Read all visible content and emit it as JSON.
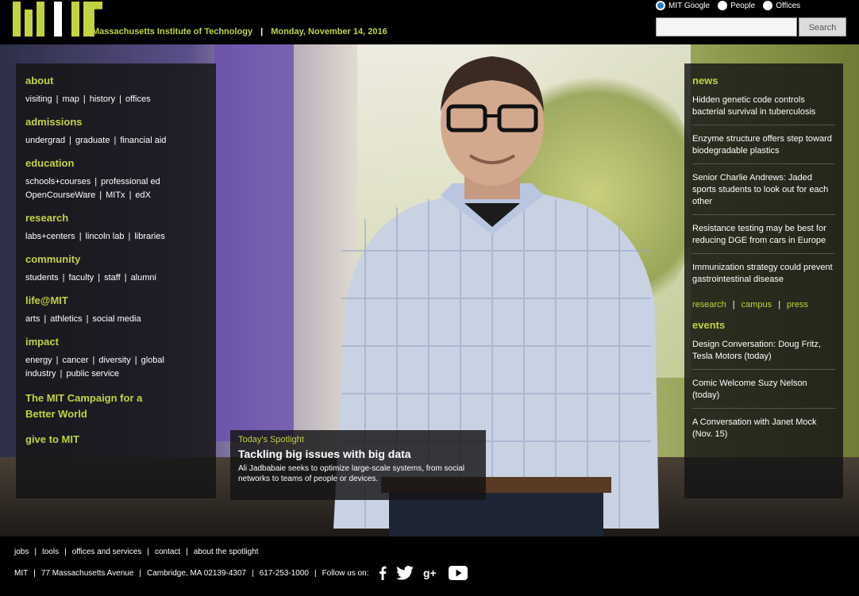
{
  "header": {
    "tagline": "Massachusetts Institute of Technology",
    "date": "Monday, November 14, 2016",
    "search_options": [
      {
        "label": "MIT Google",
        "selected": true
      },
      {
        "label": "People",
        "selected": false
      },
      {
        "label": "Offices",
        "selected": false
      }
    ],
    "search_placeholder": "",
    "search_button": "Search"
  },
  "left_nav": [
    {
      "title": "about",
      "links": [
        "visiting",
        "map",
        "history",
        "offices"
      ]
    },
    {
      "title": "admissions",
      "links": [
        "undergrad",
        "graduate",
        "financial aid"
      ]
    },
    {
      "title": "education",
      "links": [
        "schools+courses",
        "professional ed",
        "OpenCourseWare",
        "MITx",
        "edX"
      ]
    },
    {
      "title": "research",
      "links": [
        "labs+centers",
        "lincoln lab",
        "libraries"
      ]
    },
    {
      "title": "community",
      "links": [
        "students",
        "faculty",
        "staff",
        "alumni"
      ]
    },
    {
      "title": "life@MIT",
      "links": [
        "arts",
        "athletics",
        "social media"
      ]
    },
    {
      "title": "impact",
      "links": [
        "energy",
        "cancer",
        "diversity",
        "global",
        "industry",
        "public service"
      ]
    }
  ],
  "campaign": "The MIT Campaign for a Better World",
  "give": "give to MIT",
  "news": {
    "title": "news",
    "items": [
      "Hidden genetic code controls bacterial survival in tuberculosis",
      "Enzyme structure offers step toward biodegradable plastics",
      "Senior Charlie Andrews: Jaded sports students to look out for each other",
      "Resistance testing may be best for reducing DGE from cars in Europe",
      "Immunization strategy could prevent gastrointestinal disease"
    ],
    "links": [
      "research",
      "campus",
      "press"
    ]
  },
  "events": {
    "title": "events",
    "items": [
      "Design Conversation: Doug Fritz, Tesla Motors (today)",
      "Comic Welcome Suzy Nelson (today)",
      "A Conversation with Janet Mock (Nov. 15)"
    ]
  },
  "spotlight": {
    "label": "Today's Spotlight",
    "title": "Tackling big issues with big data",
    "description": "Ali Jadbabaie seeks to optimize large-scale systems, from social networks to teams of people or devices."
  },
  "footer": {
    "links": [
      "jobs",
      "tools",
      "offices and services",
      "contact",
      "about the spotlight"
    ],
    "info": [
      "MIT",
      "77 Massachusetts Avenue",
      "Cambridge, MA 02139-4307",
      "617-253-1000"
    ],
    "follow_label": "Follow us on:",
    "social": [
      "facebook-icon",
      "twitter-icon",
      "google-plus-icon",
      "youtube-icon"
    ]
  },
  "colors": {
    "accent": "#c3d33f",
    "panel": "#141414",
    "background": "#000000"
  }
}
